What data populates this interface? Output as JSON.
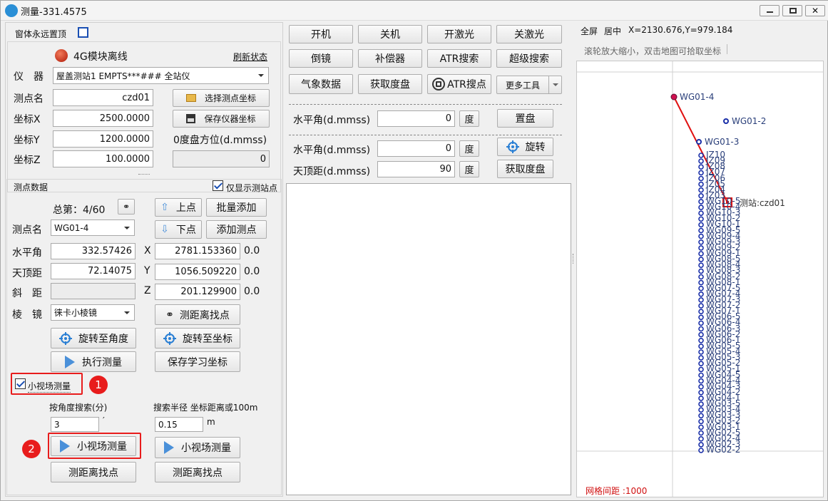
{
  "title": "测量-331.4575",
  "left": {
    "always_on_top": "窗体永远置顶",
    "module_status": "4G模块离线",
    "refresh": "刷新状态",
    "instrument_label": "仪　器",
    "instrument_value": "屋盖测站1 EMPTS***### 全站仪",
    "station_label": "测点名",
    "station_value": "czd01",
    "select_coord_btn": "选择测点坐标",
    "x_label": "坐标X",
    "x_value": "2500.0000",
    "save_coord_btn": "保存仪器坐标",
    "y_label": "坐标Y",
    "y_value": "1200.0000",
    "zero_label": "0度盘方位(d.mmss)",
    "z_label": "坐标Z",
    "z_value": "100.0000",
    "zero_value": "0"
  },
  "data": {
    "section": "测点数据",
    "only_station": "仅显示测站点",
    "total": "总第：4/60",
    "up_btn": "上点",
    "batch_add": "批量添加",
    "point_label": "测点名",
    "point_value": "WG01-4",
    "down_btn": "下点",
    "add_point": "添加测点",
    "hz_label": "水平角",
    "hz_value": "332.57426",
    "x_lbl": "X",
    "x_val": "2781.153360",
    "x_delta": "0.0",
    "v_label": "天顶距",
    "v_value": "72.14075",
    "y_lbl": "Y",
    "y_val": "1056.509220",
    "y_delta": "0.0",
    "sd_label": "斜　距",
    "z_lbl": "Z",
    "z_val": "201.129900",
    "z_delta": "0.0",
    "prism_label": "棱　镜",
    "prism_value": "徕卡小棱镜",
    "find_point_btn": "测距离找点",
    "rotate_angle_btn": "旋转至角度",
    "rotate_coord_btn": "旋转至坐标",
    "exec_btn": "执行测量",
    "save_learn_btn": "保存学习坐标",
    "small_field_chk": "小视场测量",
    "angle_search_label": "按角度搜索(分)",
    "radius_label": "搜索半径 坐标距离或100m",
    "angle_value": "3",
    "angle_unit": "′",
    "radius_value": "0.15",
    "radius_unit": "m",
    "small_field_btn1": "小视场测量",
    "small_field_btn2": "小视场测量",
    "find_btn1": "测距离找点",
    "find_btn2": "测距离找点",
    "badge1": "1",
    "badge2": "2"
  },
  "mid": {
    "row1": [
      "开机",
      "关机",
      "开激光",
      "关激光"
    ],
    "row2": [
      "倒镜",
      "补偿器",
      "ATR搜索",
      "超级搜索"
    ],
    "row3": [
      "气象数据",
      "获取度盘",
      "ATR搜点",
      "更多工具"
    ],
    "hz_label": "水平角(d.mmss)",
    "hz_value": "0",
    "deg": "度",
    "set_btn": "置盘",
    "hz2_label": "水平角(d.mmss)",
    "hz2_value": "0",
    "rotate_btn": "旋转",
    "zen_label": "天顶距(d.mmss)",
    "zen_value": "90",
    "get_btn": "获取度盘"
  },
  "map": {
    "fullscreen": "全屏",
    "center": "居中",
    "coords": "X=2130.676,Y=979.184",
    "hint": "滚轮放大缩小，双击地图可拾取坐标",
    "grid": "网格间距 :1000",
    "station_label": "测站:czd01",
    "top_points": [
      "WG01-4",
      "WG01-2",
      "WG01-3"
    ],
    "column_labels": [
      "JZ10",
      "JZ09",
      "JZ08",
      "JZ07",
      "JZ06",
      "JZ05",
      "JZ04",
      "JZ03",
      "WG10-5",
      "WG10-4",
      "WG10-3",
      "WG10-2",
      "WG10-1",
      "WG09-5",
      "WG09-4",
      "WG09-3",
      "WG09-2",
      "WG09-1",
      "WG08-5",
      "WG08-4",
      "WG08-3",
      "WG08-2",
      "WG08-1",
      "WG07-5",
      "WG07-4",
      "WG07-3",
      "WG07-2",
      "WG07-1",
      "WG06-5",
      "WG06-4",
      "WG06-3",
      "WG06-2",
      "WG06-1",
      "WG05-5",
      "WG05-4",
      "WG05-3",
      "WG05-2",
      "WG05-1",
      "WG04-5",
      "WG04-4",
      "WG04-3",
      "WG04-2",
      "WG04-1",
      "WG03-5",
      "WG03-4",
      "WG03-3",
      "WG03-2",
      "WG03-1",
      "WG02-5",
      "WG02-4",
      "WG02-3",
      "WG02-2"
    ]
  },
  "colors": {
    "accent_red": "#e81c1c",
    "point_blue": "#1a2fa8",
    "line_red": "#e01010"
  }
}
